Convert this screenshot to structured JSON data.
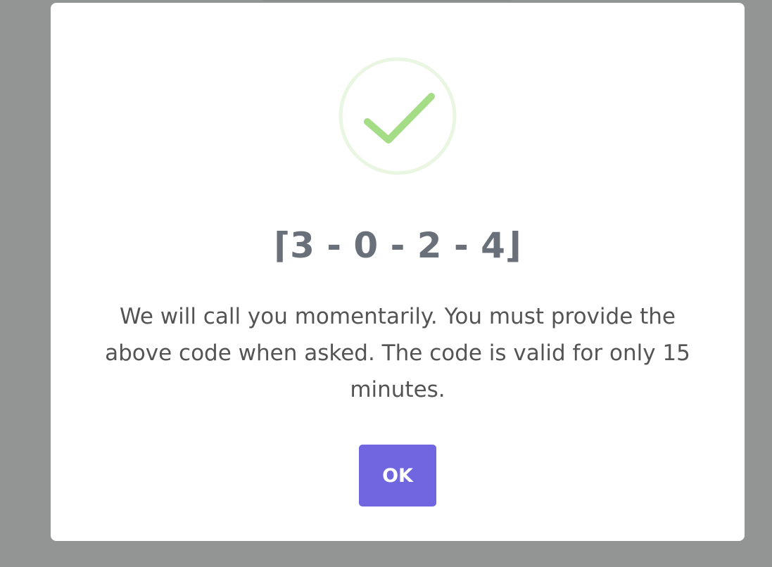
{
  "dialog": {
    "icon": "checkmark-circle-icon",
    "success_color": "#a5dc86",
    "code": "⌈3 - 0 - 2 - 4⌋",
    "message": "We will call you momentarily. You must provide the above code when asked. The code is valid for only 15 minutes.",
    "ok_label": "OK",
    "button_color": "#7066e0"
  }
}
